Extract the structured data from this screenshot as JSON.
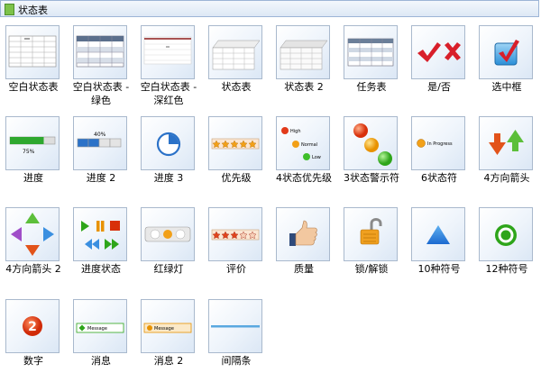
{
  "panel": {
    "title": "状态表"
  },
  "items": [
    {
      "label": "空白状态表"
    },
    {
      "label": "空白状态表 -\n绿色"
    },
    {
      "label": "空白状态表 -\n深红色"
    },
    {
      "label": "状态表"
    },
    {
      "label": "状态表 2"
    },
    {
      "label": "任务表"
    },
    {
      "label": "是/否"
    },
    {
      "label": "选中框"
    },
    {
      "label": "进度",
      "thumb_text": "75%",
      "progress": 0.75
    },
    {
      "label": "进度 2",
      "thumb_text": "40%",
      "progress": 0.4
    },
    {
      "label": "进度 3"
    },
    {
      "label": "优先级"
    },
    {
      "label": "4状态优先级",
      "thumb_text": [
        "High",
        "Normal",
        "Low"
      ]
    },
    {
      "label": "3状态警示符"
    },
    {
      "label": "6状态符",
      "thumb_text": "In Progress"
    },
    {
      "label": "4方向箭头"
    },
    {
      "label": "4方向箭头 2"
    },
    {
      "label": "进度状态"
    },
    {
      "label": "红绿灯"
    },
    {
      "label": "评价"
    },
    {
      "label": "质量"
    },
    {
      "label": "锁/解锁"
    },
    {
      "label": "10种符号"
    },
    {
      "label": "12种符号"
    },
    {
      "label": "数字",
      "thumb_text": "2"
    },
    {
      "label": "消息",
      "thumb_text": "Message"
    },
    {
      "label": "消息 2",
      "thumb_text": "Message"
    },
    {
      "label": "间隔条"
    }
  ]
}
